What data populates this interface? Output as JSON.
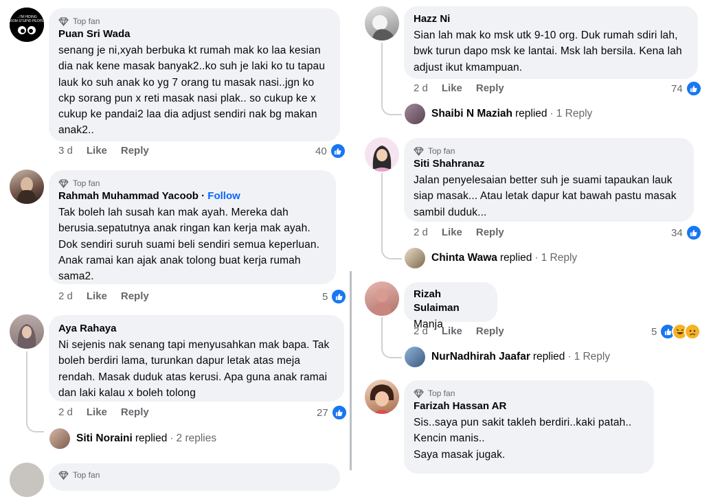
{
  "badge_label": "Top fan",
  "follow_label": "Follow",
  "like_label": "Like",
  "reply_label": "Reply",
  "left": [
    {
      "author": "Puan Sri Wada",
      "lines": [
        "senang je ni,xyah berbuka kt rumah mak ko laa kesian",
        "dia nak kene masak banyak2..ko suh je laki ko tu tapau",
        "lauk ko suh anak ko yg 7 orang tu masak nasi..jgn ko",
        "ckp sorang pun x reti masak nasi plak.. so cukup ke x",
        "cukup ke pandai2 laa dia adjust sendiri nak bg makan",
        "anak2.."
      ],
      "time": "3 d",
      "count": "40",
      "avatar_text": "...I'M HIDING FROM STUPID PEOPLE"
    },
    {
      "author": "Rahmah Muhammad Yacoob",
      "lines": [
        "Tak boleh lah susah kan mak ayah. Mereka dah",
        "berusia.sepatutnya anak ringan kan kerja mak ayah.",
        "Dok sendiri suruh suami beli sendiri semua keperluan.",
        "Anak ramai kan ajak anak tolong buat kerja rumah",
        "sama2."
      ],
      "time": "2 d",
      "count": "5"
    },
    {
      "author": "Aya Rahaya",
      "lines": [
        "Ni sejenis nak senang tapi menyusahkan mak bapa. Tak",
        "boleh berdiri lama, turunkan dapur letak atas meja",
        "rendah. Masak duduk atas kerusi. Apa guna anak ramai",
        "dan laki kalau x boleh tolong"
      ],
      "time": "2 d",
      "count": "27",
      "reply": {
        "name": "Siti Noraini",
        "verb": "replied",
        "count": "2 replies"
      }
    }
  ],
  "left_partial_badge": "Top fan",
  "right": [
    {
      "author": "Hazz Ni",
      "lines": [
        "Sian lah mak ko msk utk 9-10 org. Duk rumah sdiri lah,",
        "bwk turun dapo msk ke lantai. Msk lah bersila. Kena lah",
        "adjust ikut kmampuan."
      ],
      "time": "2 d",
      "count": "74",
      "reply": {
        "name": "Shaibi N Maziah",
        "verb": "replied",
        "count": "1 Reply"
      }
    },
    {
      "author": "Siti Shahranaz",
      "lines": [
        "Jalan penyelesaian better suh je suami tapaukan lauk",
        "siap masak... Atau letak dapur kat bawah pastu masak",
        "sambil duduk..."
      ],
      "time": "2 d",
      "count": "34",
      "reply": {
        "name": "Chinta Wawa",
        "verb": "replied",
        "count": "1 Reply"
      }
    },
    {
      "author": "Rizah Sulaiman",
      "lines": [
        "Manja"
      ],
      "time": "2 d",
      "count": "5",
      "reply": {
        "name": "NurNadhirah Jaafar",
        "verb": "replied",
        "count": "1 Reply"
      }
    },
    {
      "author": "Farizah Hassan AR",
      "lines": [
        "Sis..saya pun sakit takleh berdiri..kaki patah..",
        "Kencin manis..",
        "Saya masak jugak."
      ]
    }
  ],
  "colors": {
    "bubble": "#f0f2f5",
    "like": "#1877f2",
    "follow": "#0866ff",
    "meta": "#65676b"
  }
}
